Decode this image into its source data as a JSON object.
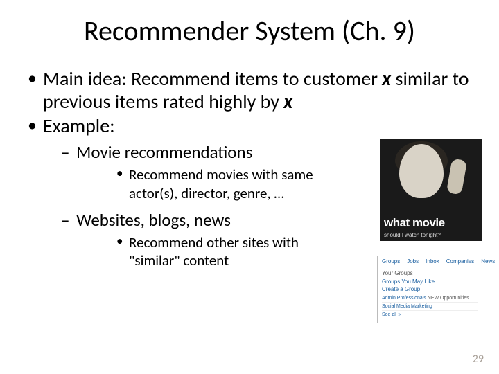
{
  "title": "Recommender System (Ch. 9)",
  "bullets": {
    "l1_1_pre": "Main idea: Recommend items to customer ",
    "l1_1_mid": " similar to previous items rated highly by ",
    "x": "x",
    "l1_2": "Example:",
    "l2_1": "Movie recommendations",
    "l3_1": "Recommend movies with same actor(s), director, genre, …",
    "l2_2": "Websites, blogs, news",
    "l3_2": "Recommend other sites with \"similar\" content"
  },
  "fig1": {
    "line1": "what movie",
    "line2": "should I watch tonight?"
  },
  "fig2": {
    "tabs": [
      "Groups",
      "Jobs",
      "Inbox",
      "Companies",
      "News"
    ],
    "panelTitle": "Your Groups",
    "panelSub1": "Groups You May Like",
    "panelSub2": "Create a Group",
    "row1a": "Admin Professionals",
    "row1b": "NEW Opportunities",
    "row2": "Social Media Marketing",
    "row3": "See all »"
  },
  "pagenum": "29"
}
